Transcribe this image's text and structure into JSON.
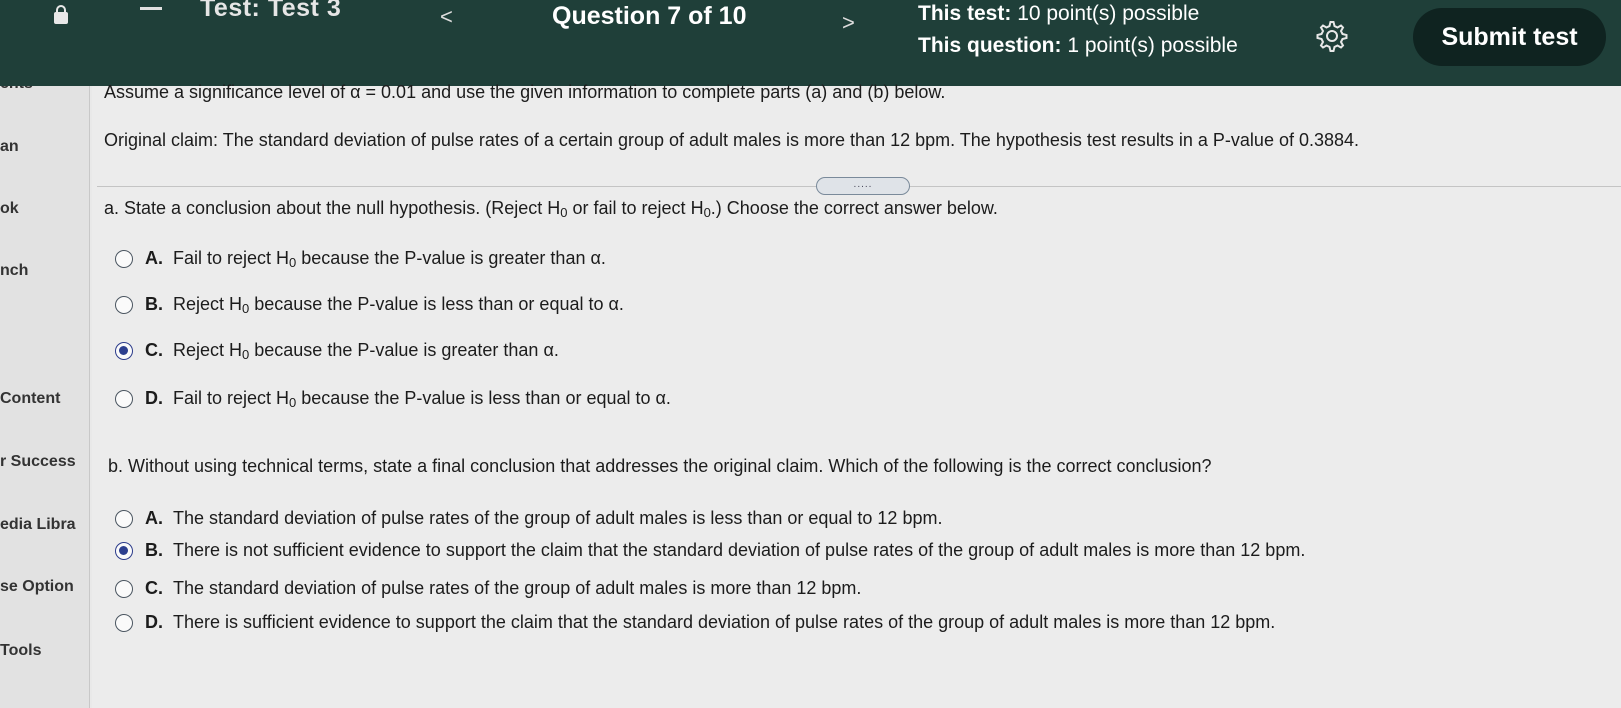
{
  "topbar": {
    "test_title": "Test: Test 3",
    "prev_glyph": "<",
    "question_of": "Question 7 of 10",
    "next_glyph": ">",
    "points_test_label": "This test:",
    "points_test_value": "10 point(s) possible",
    "points_question_label": "This question:",
    "points_question_value": "1 point(s) possible",
    "settings_icon": "gear-icon",
    "submit_label": "Submit test",
    "bar_color": "#1f3f39"
  },
  "sidebar": {
    "items": [
      "ents",
      "an",
      "ok",
      "nch",
      "Content",
      "r Success",
      "edia Libra",
      "se Option",
      "Tools"
    ]
  },
  "question": {
    "intro": "Assume a significance level of α = 0.01 and use the given information to complete parts (a) and (b) below.",
    "claim": "Original claim: The standard deviation of pulse rates of a certain group of adult males is more than 12 bpm. The hypothesis test results in a P-value of 0.3884.",
    "expander": ".....",
    "part_a": {
      "prompt_1": "a. State a conclusion about the null hypothesis. (Reject H",
      "prompt_sub_1": "0",
      "prompt_2": " or fail to reject H",
      "prompt_sub_2": "0",
      "prompt_3": ".) Choose the correct answer below.",
      "options": [
        {
          "letter": "A.",
          "pre": "Fail to reject H",
          "sub": "0",
          "post": " because the P-value is greater than α.",
          "selected": false
        },
        {
          "letter": "B.",
          "pre": "Reject H",
          "sub": "0",
          "post": " because the P-value is less than or equal to α.",
          "selected": false
        },
        {
          "letter": "C.",
          "pre": "Reject H",
          "sub": "0",
          "post": " because the P-value is greater than α.",
          "selected": true
        },
        {
          "letter": "D.",
          "pre": "Fail to reject H",
          "sub": "0",
          "post": " because the P-value is less than or equal to α.",
          "selected": false
        }
      ]
    },
    "part_b": {
      "prompt": "b. Without using technical terms, state a final conclusion that addresses the original claim. Which of the following is the correct conclusion?",
      "options": [
        {
          "letter": "A.",
          "text": "The standard deviation of pulse rates of the group of adult males is less than or equal to 12 bpm.",
          "selected": false
        },
        {
          "letter": "B.",
          "text": "There is not sufficient evidence to support the claim that the standard deviation of pulse rates of the group of adult males is more than 12 bpm.",
          "selected": true
        },
        {
          "letter": "C.",
          "text": "The standard deviation of pulse rates of the group of adult males is more than 12 bpm.",
          "selected": false
        },
        {
          "letter": "D.",
          "text": "There is sufficient evidence to support the claim that the standard deviation of pulse rates of the group of adult males is more than 12 bpm.",
          "selected": false
        }
      ]
    }
  }
}
